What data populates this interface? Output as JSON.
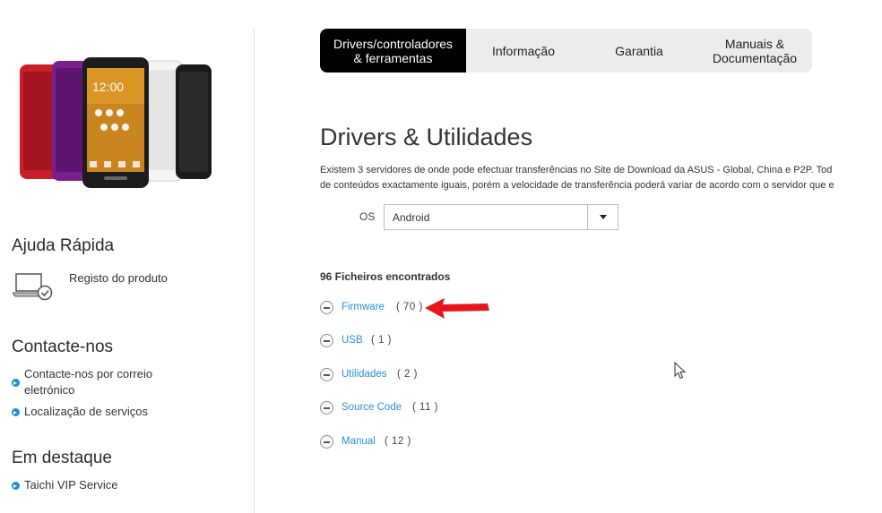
{
  "sidebar": {
    "quick_help": {
      "heading": "Ajuda Rápida",
      "items": [
        {
          "label": "Registo do produto",
          "icon": "laptop-check-icon"
        }
      ]
    },
    "contact": {
      "heading": "Contacte-nos",
      "links": [
        {
          "label": "Contacte-nos por correio eletrónico"
        },
        {
          "label": "Localização de serviços"
        }
      ]
    },
    "featured": {
      "heading": "Em destaque",
      "links": [
        {
          "label": "Taichi VIP Service"
        }
      ]
    },
    "product_image": {
      "phone_time": "12:00",
      "colors": [
        "#c8202a",
        "#7a1f8c",
        "#f0a31f",
        "#f4f4f4",
        "#1b1b1b"
      ]
    }
  },
  "tabs": [
    {
      "label": "Drivers/controladores\n& ferramentas",
      "active": true
    },
    {
      "label": "Informação",
      "active": false
    },
    {
      "label": "Garantia",
      "active": false
    },
    {
      "label": "Manuais &\nDocumentação",
      "active": false
    }
  ],
  "main": {
    "title": "Drivers & Utilidades",
    "description_lines": [
      "Existem 3 servidores de onde pode efectuar transferências no Site de Download da ASUS - Global, China e P2P. Tod",
      "de conteúdos exactamente iguais, porém a velocidade de transferência poderá variar de acordo com o servidor que e"
    ],
    "os": {
      "label": "OS",
      "value": "Android"
    },
    "files_found": "96 Ficheiros encontrados",
    "categories": [
      {
        "name": "Firmware",
        "count": "( 70 )"
      },
      {
        "name": "USB",
        "count": "( 1 )"
      },
      {
        "name": "Utilidades",
        "count": "( 2 )"
      },
      {
        "name": "Source Code",
        "count": "( 11 )"
      },
      {
        "name": "Manual",
        "count": "( 12 )"
      }
    ]
  },
  "colors": {
    "accent_link": "#2d8fd5",
    "bullet": "#1a8fd1",
    "active_tab": "#000000",
    "tab_bar": "#ececec",
    "annotation_arrow": "#e8141b"
  }
}
